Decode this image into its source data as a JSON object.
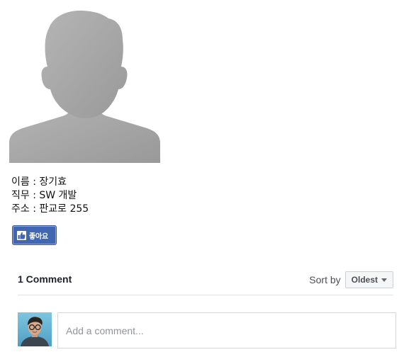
{
  "profile": {
    "name_line": "이름 : 장기효",
    "job_line": "직무 : SW 개발",
    "address_line": "주소 : 판교로 255"
  },
  "like_button": {
    "label": "좋아요",
    "icon": "thumbs-up-icon",
    "color": "#4267b2"
  },
  "comments": {
    "count_label": "1 Comment",
    "sort_label": "Sort by",
    "sort_value": "Oldest",
    "input_placeholder": "Add a comment..."
  },
  "icons": {
    "profile_placeholder": "default-profile-silhouette",
    "commenter": "commenter-avatar"
  }
}
